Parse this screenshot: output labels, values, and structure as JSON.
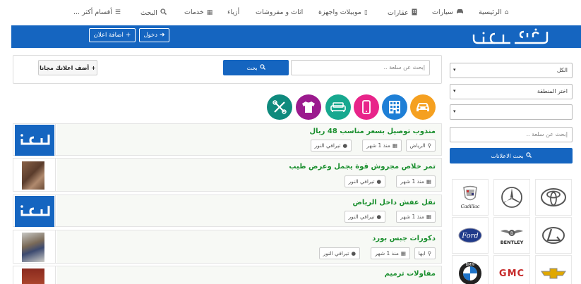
{
  "nav": {
    "items": [
      {
        "label": "الرئيسية",
        "icon": "home-icon"
      },
      {
        "label": "سيارات",
        "icon": "car-icon"
      },
      {
        "label": "عقارات",
        "icon": "building-icon"
      },
      {
        "label": "موبيلات واجهزة",
        "icon": "mobile-icon"
      },
      {
        "label": "اثاث و مفروشات",
        "icon": ""
      },
      {
        "label": "أزياء",
        "icon": ""
      },
      {
        "label": "خدمات",
        "icon": "grid-icon"
      },
      {
        "label": "البحث",
        "icon": "search-icon"
      },
      {
        "label": "أقسام أكثر ...",
        "icon": "list-icon"
      }
    ]
  },
  "header": {
    "brand_color": "#1565c0",
    "login_label": "دخول",
    "add_ad_label": "اضافة اعلان"
  },
  "search": {
    "placeholder": "إبحث عن سلعة ..",
    "button_label": "بحث",
    "add_free_label": "أضف اعلانك مجانا"
  },
  "categories": [
    {
      "name": "cars",
      "icon": "car-icon",
      "color": "#f5a020"
    },
    {
      "name": "realestate",
      "icon": "building-icon",
      "color": "#1e7fd6"
    },
    {
      "name": "mobiles",
      "icon": "mobile-icon",
      "color": "#e8248a"
    },
    {
      "name": "furniture",
      "icon": "sofa-icon",
      "color": "#17a88f"
    },
    {
      "name": "fashion",
      "icon": "shirt-icon",
      "color": "#9b1a8e"
    },
    {
      "name": "services",
      "icon": "tools-icon",
      "color": "#0f8a7d"
    }
  ],
  "listings": [
    {
      "title": "مندوب توصيل بسعر مناسب 48 ريال",
      "city": "الرياض",
      "time": "منذ 1 شهر",
      "user": "تيرافي النور",
      "thumb": "haraj"
    },
    {
      "title": "تمر خلاص مجروش قوة يجمل وعرض طيب",
      "city": "",
      "time": "منذ 1 شهر",
      "user": "تيرافي النور",
      "thumb": "photo"
    },
    {
      "title": "نقل عفش داخل الرياض",
      "city": "",
      "time": "منذ 1 شهر",
      "user": "تيرافي النور",
      "thumb": "haraj"
    },
    {
      "title": "دكورات جبس بورد",
      "city": "ابها",
      "time": "منذ 1 شهر",
      "user": "تيرافي النور",
      "thumb": "photo"
    },
    {
      "title": "مقاولات ترميم",
      "city": "",
      "time": "",
      "user": "",
      "thumb": "photo"
    }
  ],
  "sidebar": {
    "select_all": "الكل",
    "select_region": "اختر المنطقة",
    "select_third": "",
    "search_placeholder": "إبحث عن سلعة ..",
    "search_button": "بحث الاعلانات",
    "brands": [
      {
        "name": "toyota",
        "label": ""
      },
      {
        "name": "mercedes",
        "label": ""
      },
      {
        "name": "cadillac",
        "label": "Cadillac"
      },
      {
        "name": "lexus",
        "label": ""
      },
      {
        "name": "bentley",
        "label": "BENTLEY"
      },
      {
        "name": "ford",
        "label": "Ford"
      },
      {
        "name": "chevrolet",
        "label": ""
      },
      {
        "name": "gmc",
        "label": "GMC"
      },
      {
        "name": "bmw",
        "label": "BMW"
      }
    ]
  }
}
